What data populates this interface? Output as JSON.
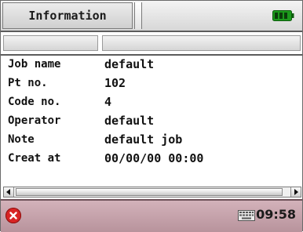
{
  "header": {
    "title": "Information",
    "battery_icon": "battery-full-icon",
    "battery_color": "#1c9a1c"
  },
  "details": {
    "rows": [
      {
        "label": "Job name",
        "value": "default"
      },
      {
        "label": "Pt no.",
        "value": "102"
      },
      {
        "label": "Code no.",
        "value": "4"
      },
      {
        "label": "Operator",
        "value": "default"
      },
      {
        "label": "Note",
        "value": "default job"
      },
      {
        "label": "Creat at",
        "value": "00/00/00 00:00"
      }
    ]
  },
  "statusbar": {
    "close_icon": "close-icon",
    "keyboard_icon": "keyboard-icon",
    "time": "09:58"
  },
  "colors": {
    "close": "#d82424",
    "statusbar": "#c3a1a9"
  }
}
